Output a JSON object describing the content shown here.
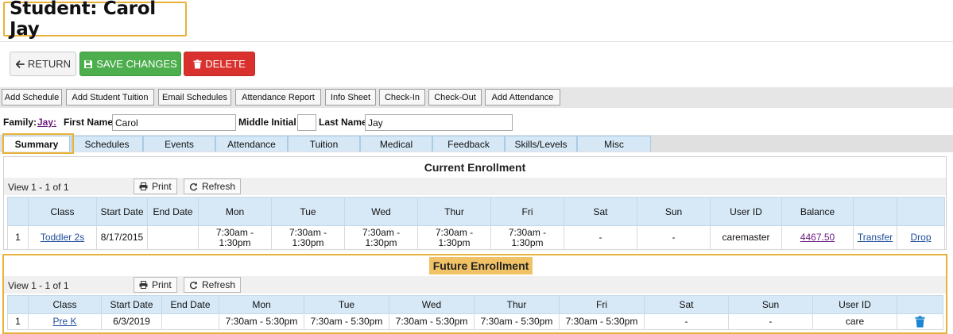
{
  "page_title": "Student: Carol Jay",
  "actions": {
    "return_label": "RETURN",
    "save_label": "SAVE CHANGES",
    "delete_label": "DELETE",
    "save_color": "#4cae4c",
    "delete_color": "#d9322e"
  },
  "toolbar": {
    "items": [
      "Add Schedule",
      "Add Student Tuition",
      "Email Schedules",
      "Attendance Report",
      "Info Sheet",
      "Check-In",
      "Check-Out",
      "Add Attendance"
    ]
  },
  "student": {
    "family_label": "Family:",
    "family_value": "Jay:",
    "first_name_label": "First Name",
    "first_name": "Carol",
    "middle_initial_label": "Middle Initial",
    "middle_initial": "",
    "last_name_label": "Last Name",
    "last_name": "Jay"
  },
  "tabs": [
    "Summary",
    "Schedules",
    "Events",
    "Attendance",
    "Tuition",
    "Medical",
    "Feedback",
    "Skills/Levels",
    "Misc"
  ],
  "current_enrollment": {
    "title": "Current Enrollment",
    "view_text": "View 1 - 1 of 1",
    "print_label": "Print",
    "refresh_label": "Refresh",
    "columns": [
      "",
      "Class",
      "Start Date",
      "End Date",
      "Mon",
      "Tue",
      "Wed",
      "Thur",
      "Fri",
      "Sat",
      "Sun",
      "User ID",
      "Balance",
      "",
      ""
    ],
    "rows": [
      {
        "num": "1",
        "class": "Toddler 2s",
        "start_date": "8/17/2015",
        "end_date": "",
        "mon": "7:30am - 1:30pm",
        "tue": "7:30am - 1:30pm",
        "wed": "7:30am - 1:30pm",
        "thur": "7:30am - 1:30pm",
        "fri": "7:30am - 1:30pm",
        "sat": "-",
        "sun": "-",
        "user_id": "caremaster",
        "balance": "4467.50",
        "transfer": "Transfer",
        "drop": "Drop"
      }
    ]
  },
  "future_enrollment": {
    "title": "Future Enrollment",
    "view_text": "View 1 - 1 of 1",
    "print_label": "Print",
    "refresh_label": "Refresh",
    "columns": [
      "",
      "Class",
      "Start Date",
      "End Date",
      "Mon",
      "Tue",
      "Wed",
      "Thur",
      "Fri",
      "Sat",
      "Sun",
      "User ID",
      ""
    ],
    "rows": [
      {
        "num": "1",
        "class": "Pre K",
        "start_date": "6/3/2019",
        "end_date": "",
        "mon": "7:30am - 5:30pm",
        "tue": "7:30am - 5:30pm",
        "wed": "7:30am - 5:30pm",
        "thur": "7:30am - 5:30pm",
        "fri": "7:30am - 5:30pm",
        "sat": "-",
        "sun": "-",
        "user_id": "care",
        "action_icon": "trash-icon"
      }
    ]
  }
}
